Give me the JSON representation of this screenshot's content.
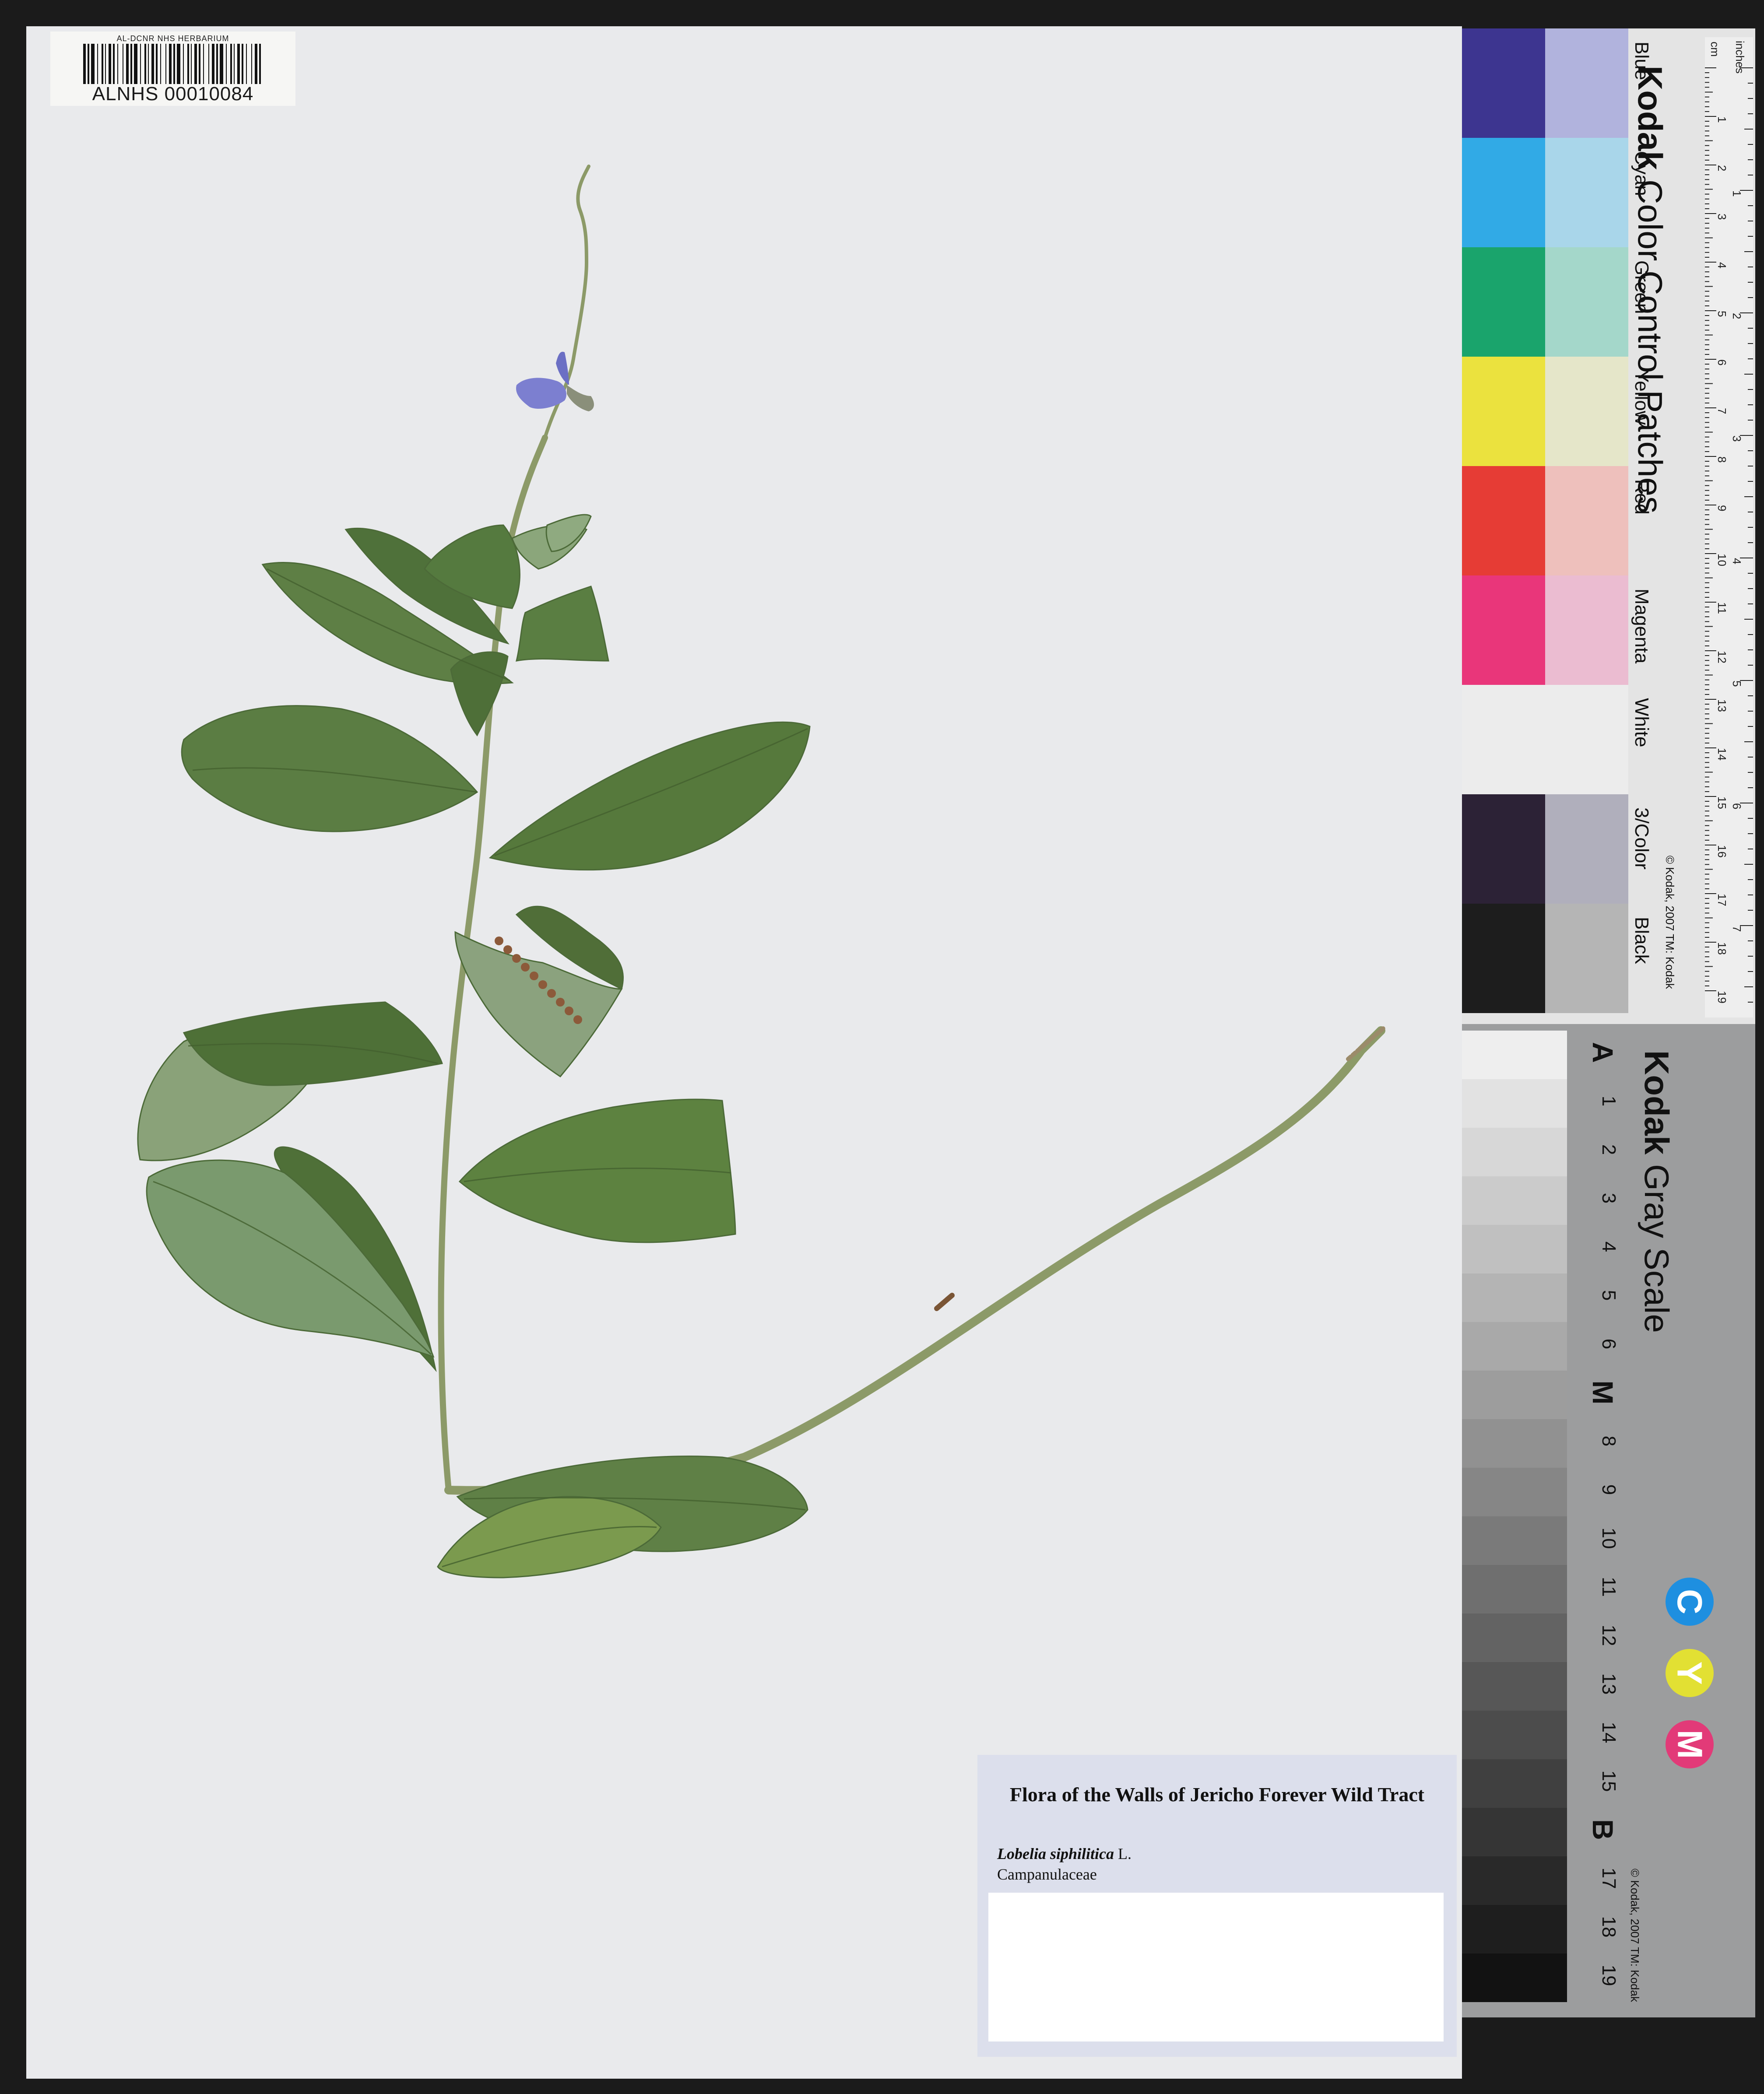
{
  "sheet": {
    "barcode_header": "AL-DCNR NHS HERBARIUM",
    "barcode_number": "ALNHS 00010084"
  },
  "label": {
    "title": "Flora of the Walls of Jericho Forever Wild Tract",
    "genus_species": "Lobelia siphilitica",
    "authority": "L.",
    "family": "Campanulaceae"
  },
  "color_card": {
    "brand": "Kodak",
    "title": "Color Control Patches",
    "patch_names": [
      "Blue",
      "Cyan",
      "Green",
      "Yellow",
      "Red",
      "Magenta",
      "White",
      "3/Color",
      "Black"
    ],
    "patch_colors": [
      [
        "#3d3590",
        "#b1b3dd"
      ],
      [
        "#31aae6",
        "#a9d6ea"
      ],
      [
        "#1aa46c",
        "#a4d7ca"
      ],
      [
        "#ebe23e",
        "#e5e6c9"
      ],
      [
        "#e63c35",
        "#eec0bc"
      ],
      [
        "#e9367a",
        "#ebbcd1"
      ],
      [
        "#ececec",
        "#ececec"
      ],
      [
        "#2c2236",
        "#b0afbc"
      ],
      [
        "#1d1d1d",
        "#b5b5b5"
      ]
    ],
    "copyright": "© Kodak, 2007 TM: Kodak",
    "ruler_units": [
      "inches",
      "cm"
    ],
    "inch_marks": [
      "1",
      "2",
      "3",
      "4",
      "5",
      "6",
      "7",
      "8"
    ],
    "cm_marks": [
      "1",
      "2",
      "3",
      "4",
      "5",
      "6",
      "7",
      "8",
      "9",
      "10",
      "11",
      "12",
      "13",
      "14",
      "15",
      "16",
      "17",
      "18",
      "19"
    ]
  },
  "gray_card": {
    "brand": "Kodak",
    "title": "Gray Scale",
    "steps": [
      "A",
      "1",
      "2",
      "3",
      "4",
      "5",
      "6",
      "M",
      "8",
      "9",
      "10",
      "11",
      "12",
      "13",
      "14",
      "15",
      "B",
      "17",
      "18",
      "19"
    ],
    "cmy": [
      "C",
      "Y",
      "M"
    ],
    "cmy_colors": [
      "#1e8fe0",
      "#e2e033",
      "#e23a78"
    ],
    "copyright": "© Kodak, 2007 TM: Kodak"
  },
  "plant": {
    "leaf_color": "#5f7f48",
    "leaf_color_light": "#7b9665",
    "stem_color": "#8c9a68",
    "flower_color": "#7c7fd0"
  }
}
